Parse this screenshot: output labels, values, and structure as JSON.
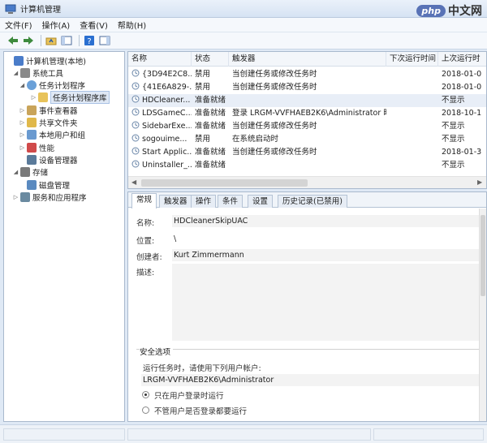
{
  "window": {
    "title": "计算机管理"
  },
  "brand": {
    "badge": "php",
    "text": "中文网"
  },
  "menu": [
    {
      "label": "文件(F)"
    },
    {
      "label": "操作(A)"
    },
    {
      "label": "查看(V)"
    },
    {
      "label": "帮助(H)"
    }
  ],
  "tree": [
    {
      "label": "计算机管理(本地)",
      "icon": "computer-icon",
      "twisty": "",
      "level": 0
    },
    {
      "label": "系统工具",
      "icon": "tools-icon",
      "twisty": "◢",
      "level": 1
    },
    {
      "label": "任务计划程序",
      "icon": "clock-icon",
      "twisty": "◢",
      "level": 2
    },
    {
      "label": "任务计划程序库",
      "icon": "folder-icon",
      "twisty": "▷",
      "level": 3,
      "selected": true
    },
    {
      "label": "事件查看器",
      "icon": "event-viewer-icon",
      "twisty": "▷",
      "level": 2
    },
    {
      "label": "共享文件夹",
      "icon": "shared-folder-icon",
      "twisty": "▷",
      "level": 2
    },
    {
      "label": "本地用户和组",
      "icon": "users-icon",
      "twisty": "▷",
      "level": 2
    },
    {
      "label": "性能",
      "icon": "performance-icon",
      "twisty": "▷",
      "level": 2
    },
    {
      "label": "设备管理器",
      "icon": "device-manager-icon",
      "twisty": "",
      "level": 2
    },
    {
      "label": "存储",
      "icon": "storage-icon",
      "twisty": "◢",
      "level": 1
    },
    {
      "label": "磁盘管理",
      "icon": "disk-icon",
      "twisty": "",
      "level": 2
    },
    {
      "label": "服务和应用程序",
      "icon": "services-icon",
      "twisty": "▷",
      "level": 1
    }
  ],
  "list": {
    "columns": [
      "名称",
      "状态",
      "触发器",
      "下次运行时间",
      "上次运行时"
    ],
    "rows": [
      {
        "name": "{3D94E2C8...",
        "status": "禁用",
        "trigger": "当创建任务或修改任务时",
        "next": "",
        "last": "2018-01-0"
      },
      {
        "name": "{41E6A829-...",
        "status": "禁用",
        "trigger": "当创建任务或修改任务时",
        "next": "",
        "last": "2018-01-0"
      },
      {
        "name": "HDCleaner...",
        "status": "准备就绪",
        "trigger": "",
        "next": "",
        "last": "不显示"
      },
      {
        "name": "LDSGameC...",
        "status": "准备就绪",
        "trigger": "登录 LRGM-VVFHAEB2K6\\Administrator 时",
        "next": "",
        "last": "2018-10-1"
      },
      {
        "name": "SidebarExe...",
        "status": "准备就绪",
        "trigger": "当创建任务或修改任务时",
        "next": "",
        "last": "不显示"
      },
      {
        "name": "sogouime...",
        "status": "禁用",
        "trigger": "在系统启动时",
        "next": "",
        "last": "不显示"
      },
      {
        "name": "Start Applic...",
        "status": "准备就绪",
        "trigger": "当创建任务或修改任务时",
        "next": "",
        "last": "2018-01-3"
      },
      {
        "name": "Uninstaller_...",
        "status": "准备就绪",
        "trigger": "",
        "next": "",
        "last": "不显示"
      }
    ]
  },
  "tabs": [
    "常规",
    "触发器",
    "操作",
    "条件",
    "设置",
    "历史记录(已禁用)"
  ],
  "general": {
    "name_label": "名称:",
    "name_value": "HDCleanerSkipUAC",
    "location_label": "位置:",
    "location_value": "\\",
    "author_label": "创建者:",
    "author_value": "Kurt Zimmermann",
    "description_label": "描述:",
    "security_label": "安全选项",
    "run_as_label": "运行任务时，请使用下列用户帐户:",
    "run_as_value": "LRGM-VVFHAEB2K6\\Administrator",
    "option1": "只在用户登录时运行",
    "option2": "不管用户是否登录都要运行"
  },
  "colors": {
    "accent": "#3d6fc4",
    "selection": "#dfe8f5"
  }
}
